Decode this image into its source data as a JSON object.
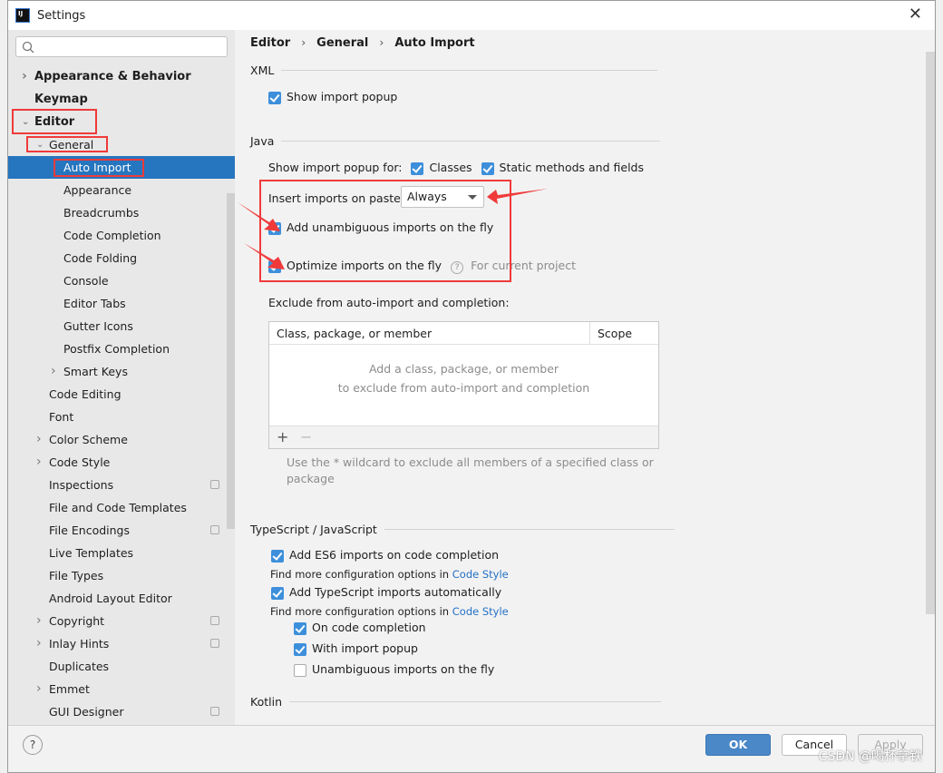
{
  "window": {
    "title": "Settings"
  },
  "sidebar": {
    "items": [
      {
        "label": "Appearance & Behavior",
        "level": 0,
        "bold": true,
        "chevron": "right"
      },
      {
        "label": "Keymap",
        "level": 0,
        "bold": true
      },
      {
        "label": "Editor",
        "level": 0,
        "bold": true,
        "chevron": "down"
      },
      {
        "label": "General",
        "level": 1,
        "chevron": "down"
      },
      {
        "label": "Auto Import",
        "level": 2,
        "selected": true
      },
      {
        "label": "Appearance",
        "level": 2
      },
      {
        "label": "Breadcrumbs",
        "level": 2
      },
      {
        "label": "Code Completion",
        "level": 2
      },
      {
        "label": "Code Folding",
        "level": 2
      },
      {
        "label": "Console",
        "level": 2
      },
      {
        "label": "Editor Tabs",
        "level": 2
      },
      {
        "label": "Gutter Icons",
        "level": 2
      },
      {
        "label": "Postfix Completion",
        "level": 2
      },
      {
        "label": "Smart Keys",
        "level": 2,
        "chevron": "right"
      },
      {
        "label": "Code Editing",
        "level": 1
      },
      {
        "label": "Font",
        "level": 1
      },
      {
        "label": "Color Scheme",
        "level": 1,
        "chevron": "right"
      },
      {
        "label": "Code Style",
        "level": 1,
        "chevron": "right"
      },
      {
        "label": "Inspections",
        "level": 1,
        "project": true
      },
      {
        "label": "File and Code Templates",
        "level": 1
      },
      {
        "label": "File Encodings",
        "level": 1,
        "project": true
      },
      {
        "label": "Live Templates",
        "level": 1
      },
      {
        "label": "File Types",
        "level": 1
      },
      {
        "label": "Android Layout Editor",
        "level": 1
      },
      {
        "label": "Copyright",
        "level": 1,
        "chevron": "right",
        "project": true
      },
      {
        "label": "Inlay Hints",
        "level": 1,
        "chevron": "right",
        "project": true
      },
      {
        "label": "Duplicates",
        "level": 1
      },
      {
        "label": "Emmet",
        "level": 1,
        "chevron": "right"
      },
      {
        "label": "GUI Designer",
        "level": 1,
        "project": true
      }
    ]
  },
  "breadcrumb": [
    "Editor",
    "General",
    "Auto Import"
  ],
  "xml": {
    "title": "XML",
    "show_import_popup": "Show import popup"
  },
  "java": {
    "title": "Java",
    "popup_for": "Show import popup for:",
    "classes": "Classes",
    "static": "Static methods and fields",
    "insert_label": "Insert imports on paste:",
    "insert_value": "Always",
    "add_unambiguous": "Add unambiguous imports on the fly",
    "optimize": "Optimize imports on the fly",
    "for_project": "For current project",
    "exclude_label": "Exclude from auto-import and completion:",
    "table": {
      "col1": "Class, package, or member",
      "col2": "Scope",
      "empty1": "Add a class, package, or member",
      "empty2": "to exclude from auto-import and completion",
      "add": "+",
      "remove": "−"
    },
    "hint1": "Use the * wildcard to exclude all members of a specified class or",
    "hint2": "package"
  },
  "ts": {
    "title": "TypeScript / JavaScript",
    "es6": "Add ES6 imports on code completion",
    "more": "Find more configuration options in",
    "code_style": "Code Style",
    "ts_auto": "Add TypeScript imports automatically",
    "on_completion": "On code completion",
    "with_popup": "With import popup",
    "unambiguous": "Unambiguous imports on the fly"
  },
  "kotlin": {
    "title": "Kotlin"
  },
  "footer": {
    "ok": "OK",
    "cancel": "Cancel",
    "apply": "Apply",
    "help": "?"
  },
  "watermark": "CSDN @喝杯拿铁",
  "colors": {
    "selection": "#2675bf",
    "checkbox": "#3d8fdb",
    "annotation": "#f03a3a",
    "link": "#2470c6"
  }
}
